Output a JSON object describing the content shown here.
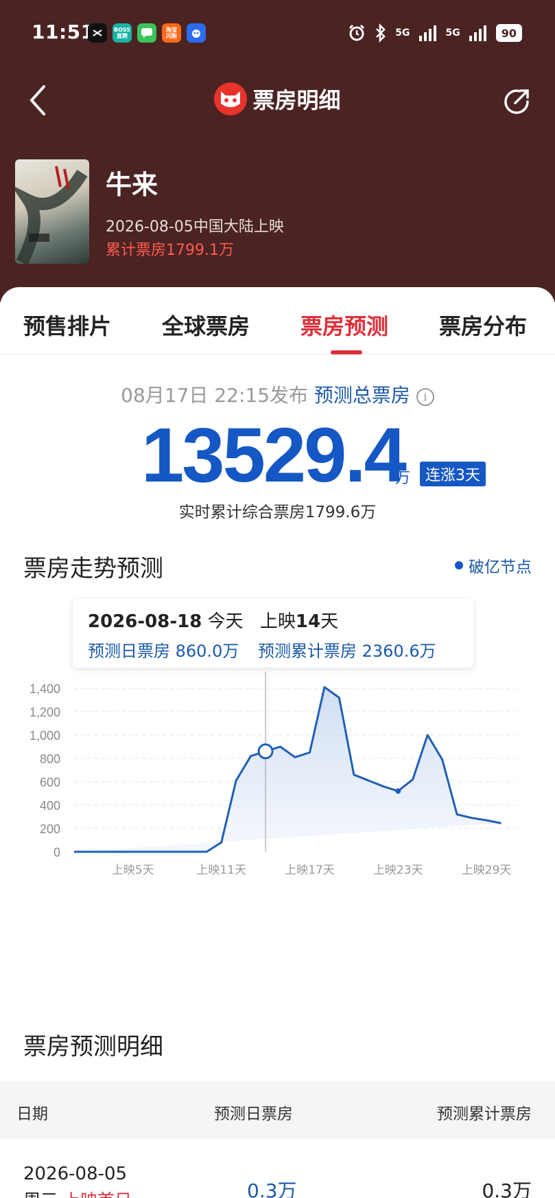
{
  "status_bar": {
    "time": "11:51",
    "apps": [
      "CapCut",
      "BOSS直聘",
      "Messages",
      "淘宝闪购",
      "Baidu"
    ],
    "app_labels": {
      "boss": "BOSS\n直聘",
      "taobao": "淘宝\n闪购"
    },
    "network_1": "5G",
    "network_2": "5G",
    "battery": "90"
  },
  "nav": {
    "title": "票房明细"
  },
  "movie": {
    "title": "牛来",
    "release": "2026-08-05中国大陆上映",
    "gross": "累计票房1799.1万"
  },
  "tabs": [
    {
      "label": "预售排片",
      "active": false
    },
    {
      "label": "全球票房",
      "active": false
    },
    {
      "label": "票房预测",
      "active": true
    },
    {
      "label": "票房分布",
      "active": false
    }
  ],
  "forecast": {
    "published": "08月17日 22:15发布",
    "label": "预测总票房",
    "total": "13529.4",
    "unit": "万",
    "streak_badge": "连涨3天",
    "realtime": "实时累计综合票房1799.6万"
  },
  "trend": {
    "title": "票房走势预测",
    "legend": "破亿节点",
    "tooltip": {
      "date": "2026-08-18",
      "today": "今天",
      "days_prefix": "上映",
      "days": "14",
      "days_suffix": "天",
      "daily": "预测日票房 860.0万",
      "cumulative": "预测累计票房 2360.6万"
    }
  },
  "chart_data": {
    "type": "area",
    "x": [
      1,
      2,
      3,
      4,
      5,
      6,
      7,
      8,
      9,
      10,
      11,
      12,
      13,
      14,
      15,
      16,
      17,
      18,
      19,
      20,
      21,
      22,
      23,
      24,
      25,
      26,
      27,
      28,
      29,
      30,
      31
    ],
    "values": [
      0,
      0,
      0,
      0,
      0,
      0,
      0,
      0,
      0,
      0,
      80,
      610,
      820,
      860,
      900,
      810,
      850,
      1410,
      1320,
      660,
      610,
      560,
      520,
      620,
      1000,
      790,
      320,
      290,
      270,
      245
    ],
    "x_tick_labels": [
      "上映5天",
      "上映11天",
      "上映17天",
      "上映23天",
      "上映29天"
    ],
    "x_ticks": [
      5,
      11,
      17,
      23,
      29
    ],
    "y_tick_labels": [
      "0",
      "200",
      "400",
      "600",
      "800",
      "1,000",
      "1,200",
      "1,400"
    ],
    "ylim": [
      0,
      1400
    ],
    "highlight_x": 14,
    "grid": true,
    "color": "#1f5fb5"
  },
  "detail": {
    "title": "票房预测明细",
    "columns": [
      "日期",
      "预测日票房",
      "预测累计票房"
    ],
    "rows": [
      {
        "date": "2026-08-05",
        "weekday": "周三",
        "tag": "上映首日",
        "daily": "0.3万",
        "cumulative": "0.3万"
      }
    ]
  },
  "colors": {
    "header_bg": "#4a2322",
    "accent_red": "#dd2f3a",
    "accent_blue": "#1557c4"
  }
}
